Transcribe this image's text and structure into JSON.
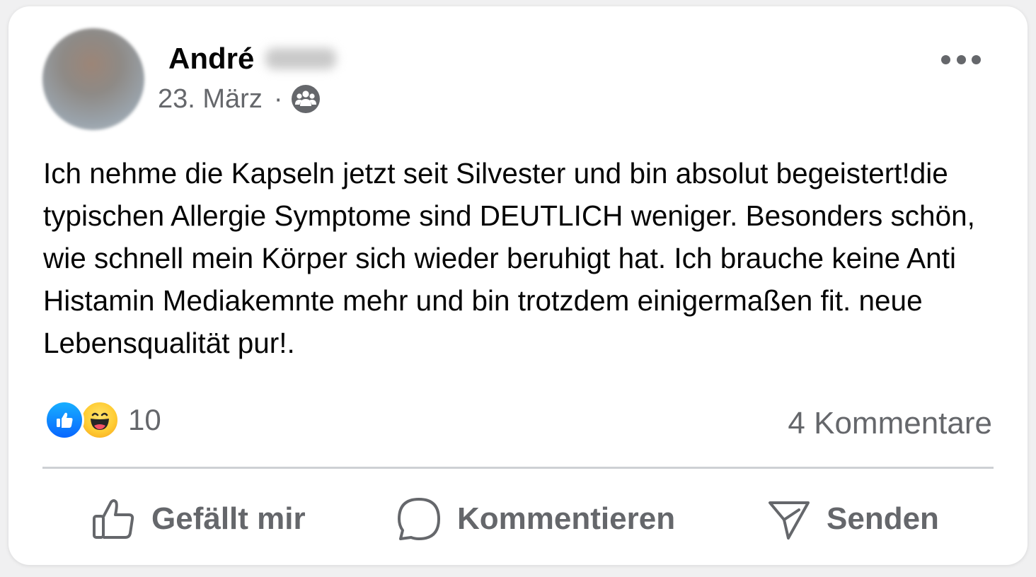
{
  "post": {
    "author_first_name": "André",
    "date": "23. März",
    "separator": "·",
    "text": "Ich nehme die Kapseln jetzt seit Silvester und bin absolut begeistert!die typischen Allergie Symptome sind DEUTLICH weniger. Besonders schön, wie schnell mein Körper sich wieder beruhigt hat. Ich brauche keine Anti Histamin Mediakemnte mehr und bin trotzdem einigermaßen fit. neue Lebensqualität pur!."
  },
  "reactions": {
    "types": [
      "like-icon",
      "haha-icon"
    ],
    "count": "10",
    "comments": "4 Kommentare"
  },
  "actions": {
    "like_label": "Gefällt mir",
    "comment_label": "Kommentieren",
    "send_label": "Senden"
  },
  "colors": {
    "secondary_text": "#65676b",
    "primary_text": "#050505",
    "like_blue": "#0866ff",
    "haha_yellow": "#ffcc33",
    "divider": "#ced0d4"
  }
}
